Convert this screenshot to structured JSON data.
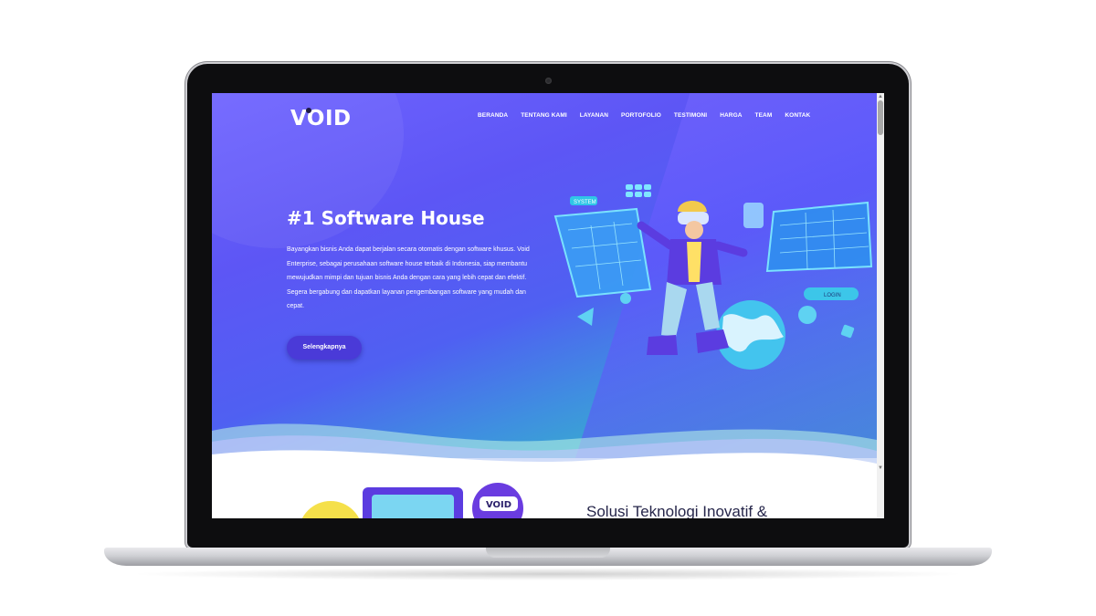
{
  "brand": {
    "logo_text": "VOID"
  },
  "nav": {
    "items": [
      "BERANDA",
      "TENTANG KAMI",
      "LAYANAN",
      "PORTOFOLIO",
      "TESTIMONI",
      "HARGA",
      "TEAM",
      "KONTAK"
    ]
  },
  "hero": {
    "title": "#1 Software House",
    "description": "Bayangkan bisnis Anda dapat berjalan secara otomatis dengan software khusus. Void Enterprise, sebagai perusahaan software house terbaik di Indonesia, siap membantu mewujudkan mimpi dan tujuan bisnis Anda dengan cara yang lebih cepat dan efektif. Segera bergabung dan dapatkan layanan pengembangan software yang mudah dan cepat.",
    "button_label": "Selengkapnya"
  },
  "illustration": {
    "system_tag": "SYSTEM",
    "login_tag": "LOGIN"
  },
  "section2": {
    "title": "Solusi Teknologi Inovatif &",
    "badge_text": "VOID"
  },
  "colors": {
    "hero_purple": "#5d56f5",
    "hero_teal": "#2fd2b8",
    "button": "#4a3ad8",
    "section_title": "#26264a"
  }
}
